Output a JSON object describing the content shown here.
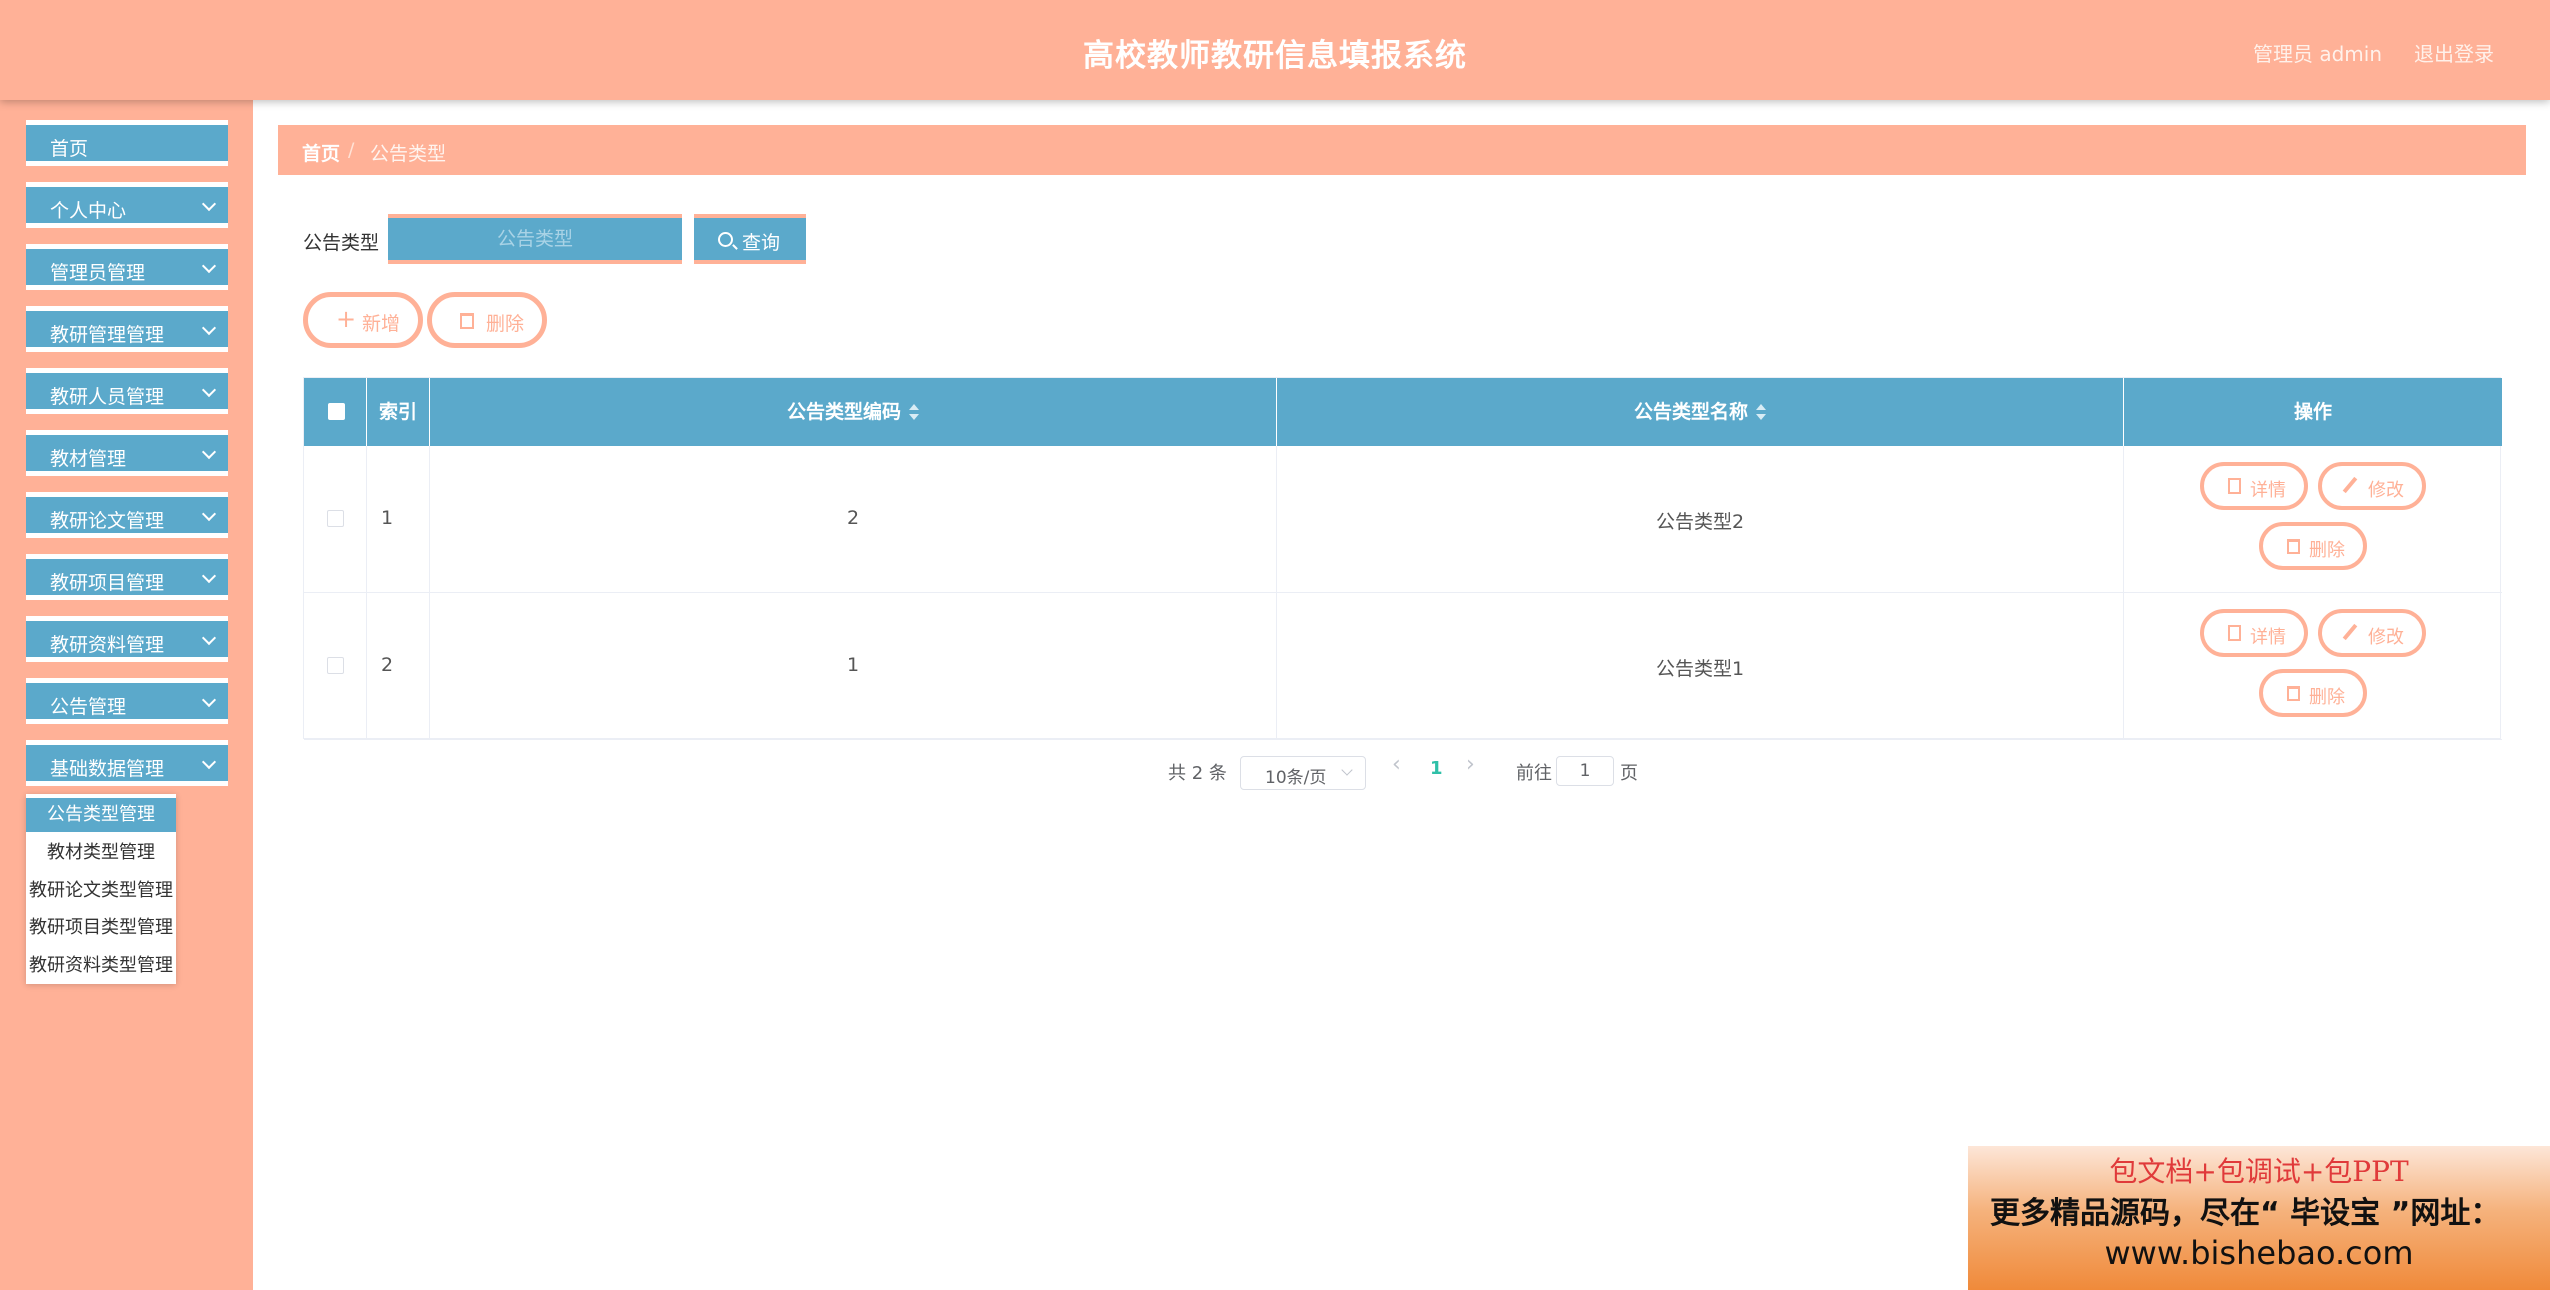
{
  "header": {
    "title": "高校教师教研信息填报系统",
    "user": "管理员 admin",
    "logout": "退出登录"
  },
  "sidebar": {
    "items": [
      {
        "label": "首页",
        "has_children": false
      },
      {
        "label": "个人中心",
        "has_children": true
      },
      {
        "label": "管理员管理",
        "has_children": true
      },
      {
        "label": "教研管理管理",
        "has_children": true
      },
      {
        "label": "教研人员管理",
        "has_children": true
      },
      {
        "label": "教材管理",
        "has_children": true
      },
      {
        "label": "教研论文管理",
        "has_children": true
      },
      {
        "label": "教研项目管理",
        "has_children": true
      },
      {
        "label": "教研资料管理",
        "has_children": true
      },
      {
        "label": "公告管理",
        "has_children": true
      },
      {
        "label": "基础数据管理",
        "has_children": true
      }
    ],
    "submenu": [
      {
        "label": "公告类型管理",
        "active": true
      },
      {
        "label": "教材类型管理",
        "active": false
      },
      {
        "label": "教研论文类型管理",
        "active": false
      },
      {
        "label": "教研项目类型管理",
        "active": false
      },
      {
        "label": "教研资料类型管理",
        "active": false
      }
    ]
  },
  "breadcrumb": {
    "home": "首页",
    "separator": "/",
    "current": "公告类型"
  },
  "search": {
    "label": "公告类型",
    "placeholder": "公告类型",
    "value": "",
    "button": "查询"
  },
  "actions": {
    "add": "新增",
    "delete": "删除"
  },
  "table": {
    "columns": [
      "索引",
      "公告类型编码",
      "公告类型名称",
      "操作"
    ],
    "rows": [
      {
        "index": "1",
        "code": "2",
        "name": "公告类型2"
      },
      {
        "index": "2",
        "code": "1",
        "name": "公告类型1"
      }
    ],
    "row_actions": {
      "detail": "详情",
      "edit": "修改",
      "delete": "删除"
    }
  },
  "pagination": {
    "total": "共 2 条",
    "page_size": "10条/页",
    "current_page": "1",
    "goto_label": "前往",
    "goto_value": "1",
    "page_suffix": "页"
  },
  "banner": {
    "line1": "包文档+包调试+包PPT",
    "line2": "更多精品源码，尽在“ 毕设宝 ”网址：",
    "line3": "www.bishebao.com"
  },
  "colors": {
    "accent": "#ffb197",
    "primary": "#5ba9cb",
    "page_active": "#2fc0a8"
  }
}
